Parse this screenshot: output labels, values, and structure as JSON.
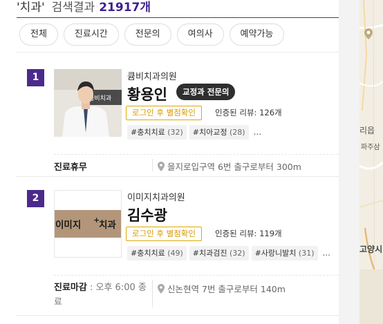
{
  "search": {
    "query": "'치과'",
    "label": "검색결과",
    "count": "21917개"
  },
  "filters": [
    "전체",
    "진료시간",
    "전문의",
    "여의사",
    "예약가능"
  ],
  "results": [
    {
      "rank": "1",
      "clinic": "큠비치과의원",
      "doctor": "황용인",
      "specialty": "교정과 전문의",
      "sign_text": "큠비치과",
      "login_label": "로그인 후 별점확인",
      "review_prefix": "인증된 리뷰:",
      "review_count": "126개",
      "tags": [
        {
          "label": "#충치치료",
          "count": "(32)"
        },
        {
          "label": "#치아교정",
          "count": "(28)"
        }
      ],
      "tags_more": "...",
      "hours_status": "진료휴무",
      "hours_detail": "",
      "hours_detail_cont": "",
      "location": "을지로입구역 6번 출구로부터 300m"
    },
    {
      "rank": "2",
      "clinic": "이미지치과의원",
      "doctor": "김수광",
      "specialty": "",
      "sign_text_a": "이미지",
      "sign_text_b": "치과",
      "login_label": "로그인 후 별점확인",
      "review_prefix": "인증된 리뷰:",
      "review_count": "119개",
      "tags": [
        {
          "label": "#충치치료",
          "count": "(49)"
        },
        {
          "label": "#치과검진",
          "count": "(32)"
        },
        {
          "label": "#사랑니발치",
          "count": "(31)"
        }
      ],
      "tags_more": "...",
      "hours_status": "진료마감",
      "hours_detail": " : 오후 6:00 종",
      "hours_detail_cont": "료",
      "location": "신논현역 7번 출구로부터 140m"
    }
  ],
  "map": {
    "labels": [
      "리읍",
      "파주삼",
      "고양시"
    ]
  },
  "colors": {
    "accent": "#4b2a8c",
    "count": "#3e1f8f",
    "badge_border": "#e0a800"
  },
  "icons": {
    "location": "map-pin-icon",
    "map": "map-marker-icon"
  }
}
